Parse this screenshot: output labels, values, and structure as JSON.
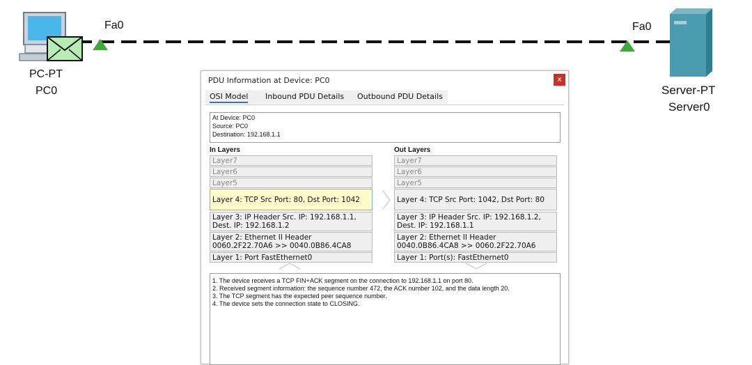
{
  "topology": {
    "pc": {
      "type_label": "PC-PT",
      "name_label": "PC0",
      "port": "Fa0"
    },
    "server": {
      "type_label": "Server-PT",
      "name_label": "Server0",
      "port": "Fa0"
    },
    "link_status_color": "#3dab3a"
  },
  "window": {
    "title": "PDU Information at Device: PC0",
    "close_label": "x",
    "tabs": [
      {
        "label": "OSI Model",
        "active": true
      },
      {
        "label": "Inbound PDU Details",
        "active": false
      },
      {
        "label": "Outbound PDU Details",
        "active": false
      }
    ],
    "info": {
      "device": "At Device: PC0",
      "source": "Source: PC0",
      "destination": "Destination: 192.168.1.1"
    },
    "in_layers": {
      "heading": "In Layers",
      "items": [
        "Layer7",
        "Layer6",
        "Layer5",
        "Layer 4: TCP Src Port: 80, Dst Port: 1042",
        "Layer 3: IP Header Src. IP: 192.168.1.1, Dest. IP: 192.168.1.2",
        "Layer 2: Ethernet II Header 0060.2F22.70A6 >> 0040.0B86.4CA8",
        "Layer 1: Port FastEthernet0"
      ]
    },
    "out_layers": {
      "heading": "Out Layers",
      "items": [
        "Layer7",
        "Layer6",
        "Layer5",
        "Layer 4: TCP Src Port: 1042, Dst Port: 80",
        "Layer 3: IP Header Src. IP: 192.168.1.2, Dest. IP: 192.168.1.1",
        "Layer 2: Ethernet II Header 0040.0B86.4CA8 >> 0060.2F22.70A6",
        "Layer 1: Port(s): FastEthernet0"
      ]
    },
    "description": [
      "1. The device receives a TCP FIN+ACK segment on the connection to 192.168.1.1 on port 80.",
      "2. Received segment information: the sequence number 472, the ACK number 102, and the data length 20.",
      "3. The TCP segment has the expected peer sequence number.",
      "4. The device sets the connection state to CLOSING."
    ]
  },
  "annotation": {
    "arrow_color": "#e02020"
  }
}
